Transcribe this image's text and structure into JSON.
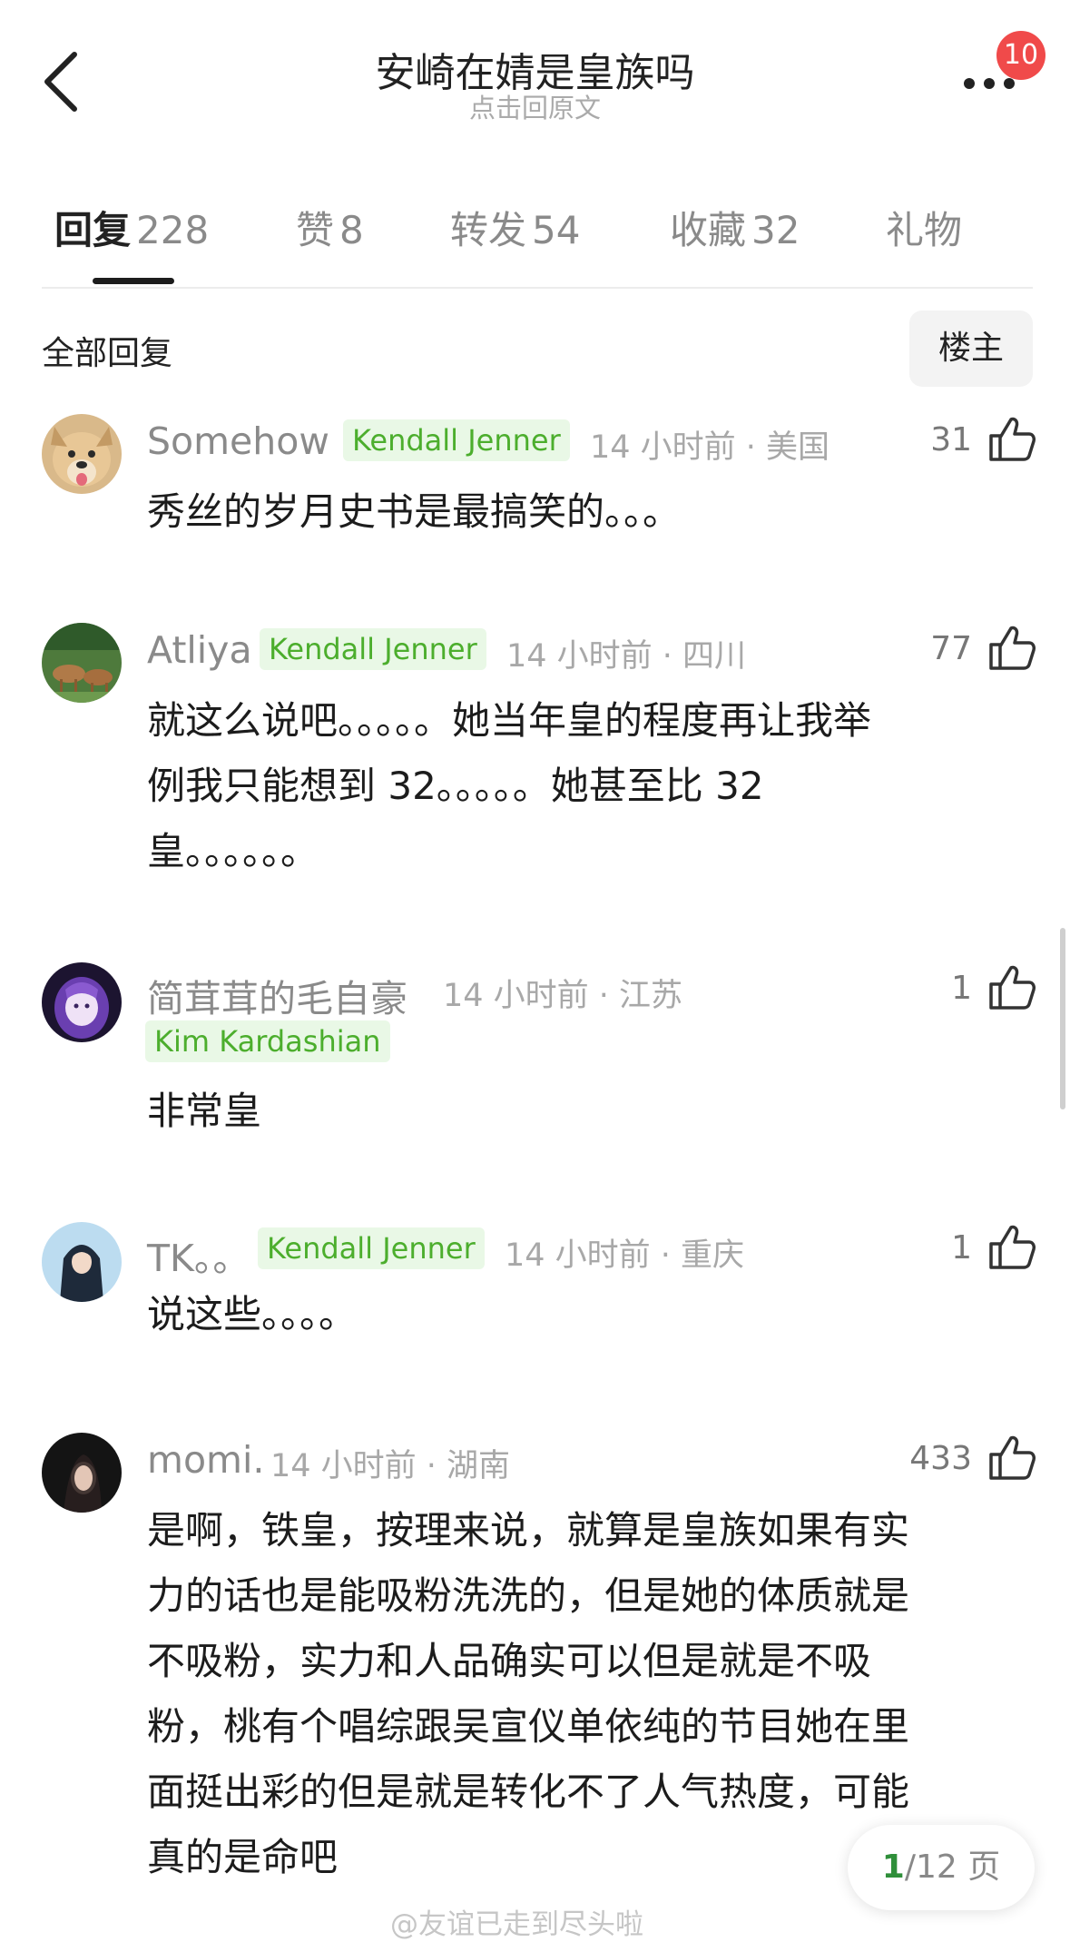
{
  "header": {
    "title": "安崎在婧是皇族吗",
    "subtitle": "点击回原文",
    "notification_count": "10"
  },
  "tabs": [
    {
      "label": "回复",
      "count": "228"
    },
    {
      "label": "赞",
      "count": "8"
    },
    {
      "label": "转发",
      "count": "54"
    },
    {
      "label": "收藏",
      "count": "32"
    },
    {
      "label": "礼物",
      "count": ""
    }
  ],
  "section": {
    "all_replies": "全部回复",
    "op_filter": "楼主"
  },
  "comments": [
    {
      "username": "Somehow",
      "tag": "Kendall Jenner",
      "time": "14 小时前 · 美国",
      "likes": "31",
      "lines": [
        "秀丝的岁月史书是最搞笑的。。。"
      ]
    },
    {
      "username": "Atliya",
      "tag": "Kendall Jenner",
      "time": "14 小时前 · 四川",
      "likes": "77",
      "lines": [
        "就这么说吧。。。。。她当年皇的程度再让我举",
        "例我只能想到 32。。。。。她甚至比 32",
        "皇。。。。。。"
      ]
    },
    {
      "username": "简茸茸的毛自豪",
      "tag": "Kim Kardashian",
      "time": "14 小时前 · 江苏",
      "likes": "1",
      "lines": [
        "非常皇"
      ]
    },
    {
      "username": "TK。。",
      "tag": "Kendall Jenner",
      "time": "14 小时前 · 重庆",
      "likes": "1",
      "lines": [
        "说这些。。。。"
      ]
    },
    {
      "username": "momi.",
      "tag": "",
      "time": "14 小时前 · 湖南",
      "likes": "433",
      "lines": [
        "是啊，铁皇，按理来说，就算是皇族如果有实",
        "力的话也是能吸粉洗洗的，但是她的体质就是",
        "不吸粉，实力和人品确实可以但是就是不吸",
        "粉，桃有个唱综跟吴宣仪单依纯的节目她在里",
        "面挺出彩的但是就是转化不了人气热度，可能",
        "真的是命吧"
      ]
    }
  ],
  "pager": {
    "current": "1",
    "total": "/12 页"
  },
  "watermark": "@友谊已走到尽头啦",
  "colors": {
    "tag_green": "#4cae2d",
    "tag_bg": "#e9f8e6",
    "badge_red": "#f04a4a",
    "pager_green": "#2f8f3a"
  }
}
